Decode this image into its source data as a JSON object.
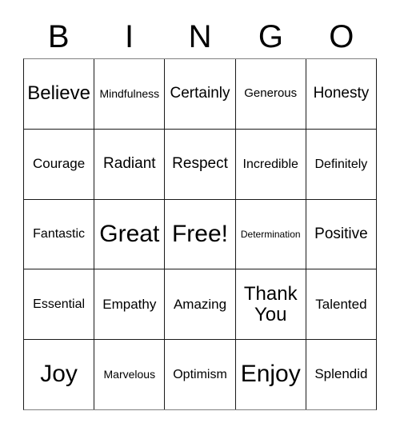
{
  "card": {
    "title": "BINGO",
    "header": {
      "letters": [
        "B",
        "I",
        "N",
        "G",
        "O"
      ]
    },
    "grid": {
      "columns": 5,
      "rows": 5,
      "cells": [
        [
          {
            "text": "Believe",
            "size": "fs-xl"
          },
          {
            "text": "Mindfulness",
            "size": "fs-sm"
          },
          {
            "text": "Certainly",
            "size": "fs-lg"
          },
          {
            "text": "Generous",
            "size": "fs-sm2"
          },
          {
            "text": "Honesty",
            "size": "fs-lg"
          }
        ],
        [
          {
            "text": "Courage",
            "size": "fs-md2"
          },
          {
            "text": "Radiant",
            "size": "fs-lg"
          },
          {
            "text": "Respect",
            "size": "fs-lg"
          },
          {
            "text": "Incredible",
            "size": "fs-md"
          },
          {
            "text": "Definitely",
            "size": "fs-md"
          }
        ],
        [
          {
            "text": "Fantastic",
            "size": "fs-md"
          },
          {
            "text": "Great",
            "size": "fs-xxl"
          },
          {
            "text": "Free!",
            "size": "fs-xxl"
          },
          {
            "text": "Determination",
            "size": "fs-xs"
          },
          {
            "text": "Positive",
            "size": "fs-lg"
          }
        ],
        [
          {
            "text": "Essential",
            "size": "fs-md"
          },
          {
            "text": "Empathy",
            "size": "fs-md2"
          },
          {
            "text": "Amazing",
            "size": "fs-md2"
          },
          {
            "text": "Thank You",
            "size": "fs-xl"
          },
          {
            "text": "Talented",
            "size": "fs-md2"
          }
        ],
        [
          {
            "text": "Joy",
            "size": "fs-xxl"
          },
          {
            "text": "Marvelous",
            "size": "fs-sm"
          },
          {
            "text": "Optimism",
            "size": "fs-md"
          },
          {
            "text": "Enjoy",
            "size": "fs-xxl"
          },
          {
            "text": "Splendid",
            "size": "fs-md2"
          }
        ]
      ]
    }
  }
}
